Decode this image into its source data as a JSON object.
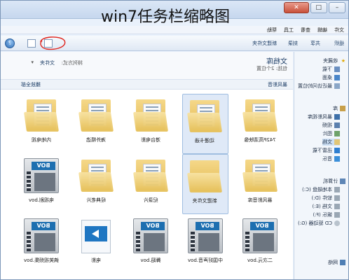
{
  "overlay": {
    "title": "win7任务栏缩略图"
  },
  "menu": {
    "items": [
      "文件",
      "编辑",
      "查看",
      "工具",
      "帮助"
    ]
  },
  "toolbar": {
    "organize": "组织",
    "share": "共享",
    "burn": "刻录",
    "new_folder": "新建文件夹"
  },
  "sidebar": {
    "items": [
      {
        "label": "收藏夹",
        "icon": "star-icon"
      },
      {
        "label": "下载",
        "icon": "download-icon"
      },
      {
        "label": "桌面",
        "icon": "desktop-icon"
      },
      {
        "label": "最近访问的位置",
        "icon": "recent-icon"
      },
      {
        "label": "库",
        "icon": "library-icon"
      },
      {
        "label": "暴风影视库",
        "icon": "video-library-icon"
      },
      {
        "label": "视频",
        "icon": "video-icon"
      },
      {
        "label": "图片",
        "icon": "picture-icon"
      },
      {
        "label": "文档",
        "icon": "document-icon"
      },
      {
        "label": "迅雷下载",
        "icon": "thunder-icon"
      },
      {
        "label": "音乐",
        "icon": "music-icon"
      },
      {
        "label": "计算机",
        "icon": "computer-icon"
      },
      {
        "label": "本地磁盘 (C:)",
        "icon": "drive-icon"
      },
      {
        "label": "软件 (D:)",
        "icon": "drive-icon"
      },
      {
        "label": "文档 (E:)",
        "icon": "drive-icon"
      },
      {
        "label": "娱乐 (F:)",
        "icon": "drive-icon"
      },
      {
        "label": "CD 驱动器 (G:)",
        "icon": "cd-icon"
      },
      {
        "label": "网络",
        "icon": "network-icon"
      }
    ]
  },
  "library": {
    "title": "文档库",
    "subtitle": "包括: 2个位置",
    "arrange_label": "排列方式:",
    "arrange_value": "文件夹"
  },
  "bar2": {
    "left": "暴风影音",
    "right": "播放全部"
  },
  "files": [
    {
      "label": "742P高清映像",
      "kind": "folder"
    },
    {
      "label": "动漫卡通",
      "kind": "folder"
    },
    {
      "label": "港台电影",
      "kind": "folder"
    },
    {
      "label": "海外精选",
      "kind": "folder"
    },
    {
      "label": "内地电视",
      "kind": "folder"
    },
    {
      "label": "暴风影音库",
      "kind": "folder"
    },
    {
      "label": "新建文件夹",
      "kind": "folder"
    },
    {
      "label": "纪录片",
      "kind": "folder"
    },
    {
      "label": "经典老片",
      "kind": "folder"
    },
    {
      "label": "电视剧.bov",
      "kind": "video"
    },
    {
      "label": "二次元.bov",
      "kind": "video"
    },
    {
      "label": "中国好声音.bov",
      "kind": "video"
    },
    {
      "label": "舞蹈.bov",
      "kind": "video"
    },
    {
      "label": "电影",
      "kind": "media"
    },
    {
      "label": "搞笑视频集.bov",
      "kind": "video"
    }
  ]
}
